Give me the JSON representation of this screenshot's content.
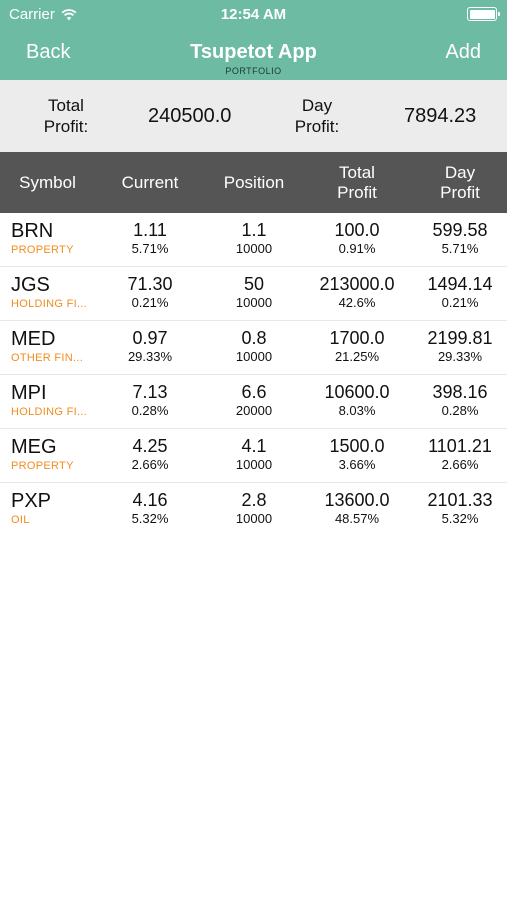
{
  "status_bar": {
    "carrier": "Carrier",
    "time": "12:54 AM"
  },
  "nav": {
    "back_label": "Back",
    "title": "Tsupetot App",
    "subtitle": "PORTFOLIO",
    "add_label": "Add"
  },
  "summary": {
    "total_profit_label_1": "Total",
    "total_profit_label_2": "Profit:",
    "total_profit_value": "240500.0",
    "day_profit_label_1": "Day",
    "day_profit_label_2": "Profit:",
    "day_profit_value": "7894.23"
  },
  "columns": {
    "symbol": "Symbol",
    "current": "Current",
    "position": "Position",
    "total_profit_1": "Total",
    "total_profit_2": "Profit",
    "day_profit_1": "Day",
    "day_profit_2": "Profit"
  },
  "rows": [
    {
      "symbol": "BRN",
      "sector": "PROPERTY",
      "current": "1.11",
      "current_pct": "5.71%",
      "position": "1.1",
      "quantity": "10000",
      "total_profit": "100.0",
      "total_pct": "0.91%",
      "day_profit": "599.58",
      "day_pct": "5.71%"
    },
    {
      "symbol": "JGS",
      "sector": "HOLDING FI...",
      "current": "71.30",
      "current_pct": "0.21%",
      "position": "50",
      "quantity": "10000",
      "total_profit": "213000.0",
      "total_pct": "42.6%",
      "day_profit": "1494.14",
      "day_pct": "0.21%"
    },
    {
      "symbol": "MED",
      "sector": "OTHER FIN...",
      "current": "0.97",
      "current_pct": "29.33%",
      "position": "0.8",
      "quantity": "10000",
      "total_profit": "1700.0",
      "total_pct": "21.25%",
      "day_profit": "2199.81",
      "day_pct": "29.33%"
    },
    {
      "symbol": "MPI",
      "sector": "HOLDING FI...",
      "current": "7.13",
      "current_pct": "0.28%",
      "position": "6.6",
      "quantity": "20000",
      "total_profit": "10600.0",
      "total_pct": "8.03%",
      "day_profit": "398.16",
      "day_pct": "0.28%"
    },
    {
      "symbol": "MEG",
      "sector": "PROPERTY",
      "current": "4.25",
      "current_pct": "2.66%",
      "position": "4.1",
      "quantity": "10000",
      "total_profit": "1500.0",
      "total_pct": "3.66%",
      "day_profit": "1101.21",
      "day_pct": "2.66%"
    },
    {
      "symbol": "PXP",
      "sector": "OIL",
      "current": "4.16",
      "current_pct": "5.32%",
      "position": "2.8",
      "quantity": "10000",
      "total_profit": "13600.0",
      "total_pct": "48.57%",
      "day_profit": "2101.33",
      "day_pct": "5.32%"
    }
  ],
  "colors": {
    "header": "#6cbba2",
    "summary_bg": "#ececec",
    "table_header": "#555555",
    "sector": "#f28c1c"
  },
  "icons": {
    "wifi": "wifi-icon",
    "battery": "battery-icon"
  }
}
